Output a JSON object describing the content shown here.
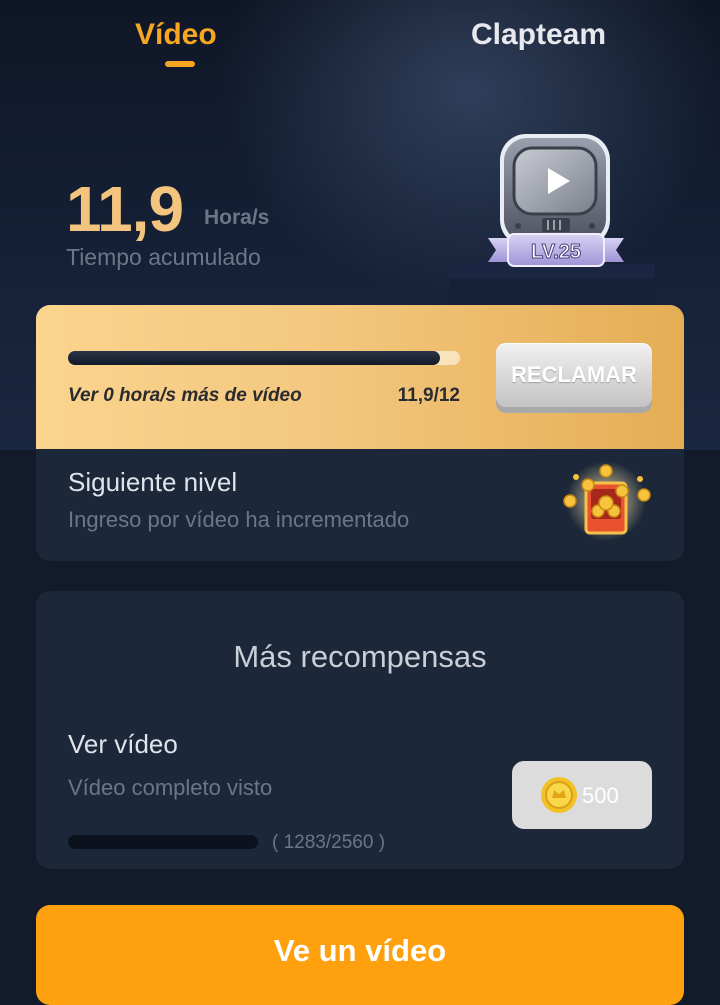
{
  "tabs": {
    "video": "Vídeo",
    "clapteam": "Clapteam"
  },
  "hours": {
    "value": "11,9",
    "unit": "Hora/s",
    "label": "Tiempo acumulado"
  },
  "level": {
    "badge": "LV.25"
  },
  "claim_card": {
    "progress_fraction": 0.95,
    "progress_label": "Ver 0 hora/s más de vídeo",
    "progress_count": "11,9/12",
    "button": "RECLAMAR",
    "next_title": "Siguiente nivel",
    "next_subtitle": "Ingreso por vídeo ha incrementado"
  },
  "rewards": {
    "title": "Más recompensas",
    "task_title": "Ver vídeo",
    "task_subtitle": "Vídeo completo visto",
    "task_progress_fraction": 0.501,
    "task_count": "( 1283/2560 )",
    "reward_value": "500"
  },
  "cta": {
    "label": "Ve un vídeo"
  },
  "colors": {
    "accent": "#f6a623",
    "cta": "#ffa10f",
    "background": "#131b2b",
    "card": "#1c273a"
  }
}
